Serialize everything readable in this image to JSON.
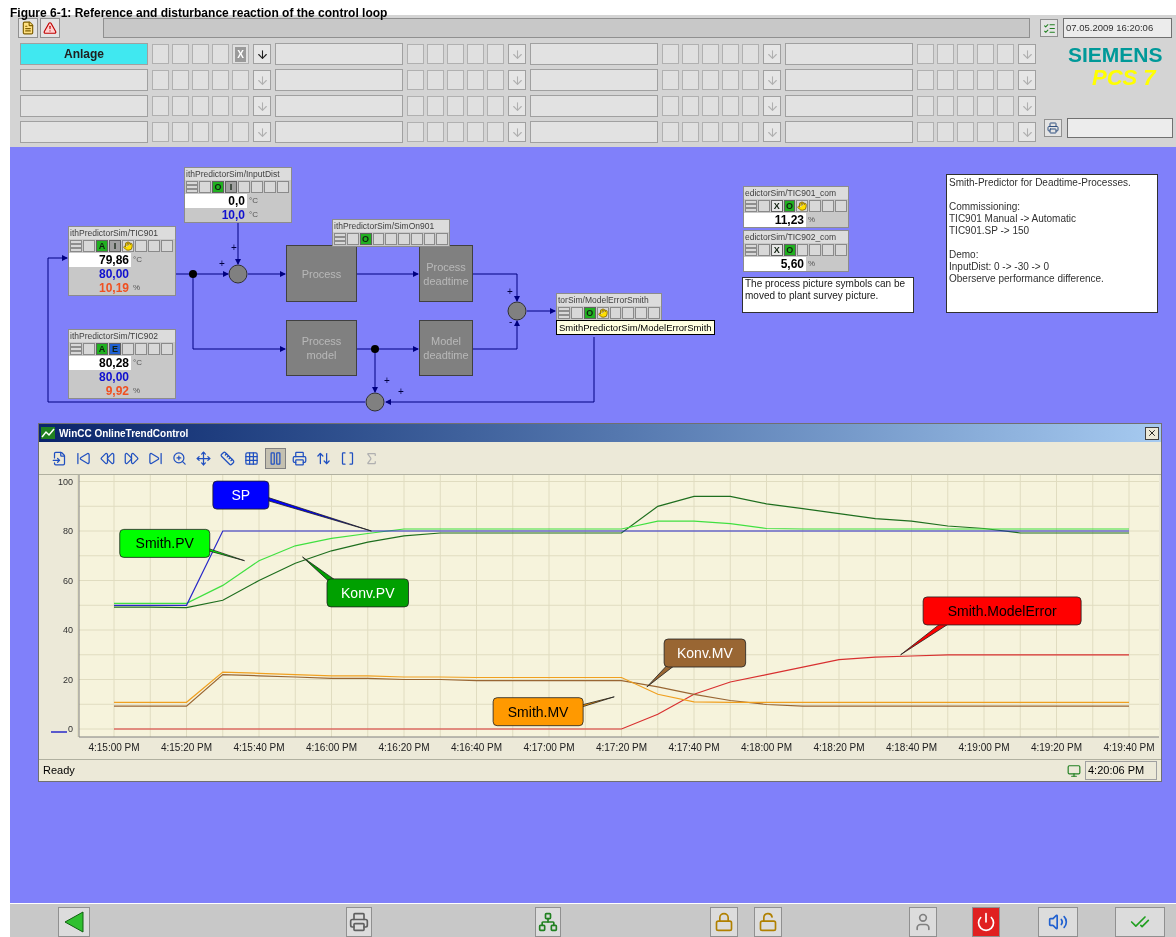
{
  "caption": "Figure 6-1: Reference and disturbance reaction of the control loop",
  "header": {
    "date": "07.05.2009 16:20:06",
    "logo": {
      "brand": "SIEMENS",
      "product": "PCS 7"
    },
    "area_rows": [
      [
        {
          "label": "Anlage",
          "selected": true,
          "marker": "X",
          "arrow_disabled": false
        },
        {
          "selected": false,
          "arrow_disabled": true
        },
        {
          "selected": false,
          "arrow_disabled": true
        },
        {
          "selected": false,
          "arrow_disabled": true
        }
      ],
      [
        {
          "selected": false,
          "arrow_disabled": true
        },
        {
          "selected": false,
          "arrow_disabled": true
        },
        {
          "selected": false,
          "arrow_disabled": true
        },
        {
          "selected": false,
          "arrow_disabled": true
        }
      ],
      [
        {
          "selected": false,
          "arrow_disabled": true
        },
        {
          "selected": false,
          "arrow_disabled": true
        },
        {
          "selected": false,
          "arrow_disabled": true
        },
        {
          "selected": false,
          "arrow_disabled": true
        }
      ],
      [
        {
          "selected": false,
          "arrow_disabled": true
        },
        {
          "selected": false,
          "arrow_disabled": true
        },
        {
          "selected": false,
          "arrow_disabled": true
        },
        {
          "selected": false,
          "arrow_disabled": true
        }
      ]
    ]
  },
  "diagram": {
    "faceplates": [
      {
        "title": "ithPredictorSim/InputDist",
        "buttons": [
          {
            "label": "O",
            "color": "#20b020"
          },
          {
            "label": "I",
            "color": "#a0a0a0"
          }
        ],
        "hand": false,
        "values": [
          {
            "value": "0,0",
            "unit": "°C",
            "kind": "pv"
          },
          {
            "value": "10,0",
            "unit": "°C",
            "kind": "sp"
          }
        ]
      },
      {
        "title": "ithPredictorSim/TIC901",
        "buttons": [
          {
            "label": "A",
            "color": "#20b020"
          },
          {
            "label": "I",
            "color": "#a0a0a0"
          }
        ],
        "hand": true,
        "values": [
          {
            "value": "79,86",
            "unit": "°C",
            "kind": "pv"
          },
          {
            "value": "80,00",
            "kind": "sp"
          },
          {
            "value": "10,19",
            "unit": "%",
            "kind": "mv"
          }
        ]
      },
      {
        "title": "ithPredictorSim/TIC902",
        "buttons": [
          {
            "label": "A",
            "color": "#20b020"
          },
          {
            "label": "E",
            "color": "#2060d0"
          }
        ],
        "hand": false,
        "values": [
          {
            "value": "80,28",
            "unit": "°C",
            "kind": "pv"
          },
          {
            "value": "80,00",
            "kind": "sp"
          },
          {
            "value": "9,92",
            "unit": "%",
            "kind": "mv"
          }
        ]
      },
      {
        "title": "ithPredictorSim/SimOn901",
        "buttons": [
          {
            "label": "O",
            "color": "#20b020"
          }
        ],
        "hand": false
      },
      {
        "title": "torSim/ModelErrorSmith",
        "buttons": [
          {
            "label": "O",
            "color": "#20b020"
          }
        ],
        "hand": true
      },
      {
        "title": "edictorSim/TIC901_com",
        "buttons": [
          {
            "label": "X",
            "color": "#e8e8e8"
          },
          {
            "label": "O",
            "color": "#20b020"
          }
        ],
        "hand": true,
        "values": [
          {
            "value": "11,23",
            "unit": "%",
            "kind": "pv"
          }
        ]
      },
      {
        "title": "edictorSim/TIC902_com",
        "buttons": [
          {
            "label": "X",
            "color": "#e8e8e8"
          },
          {
            "label": "O",
            "color": "#20b020"
          }
        ],
        "hand": false,
        "values": [
          {
            "value": "5,60",
            "unit": "%",
            "kind": "pv"
          }
        ]
      }
    ],
    "tooltip": "SmithPredictorSim/ModelErrorSmith",
    "blocks": [
      {
        "label": "Process"
      },
      {
        "label": "Process deadtime"
      },
      {
        "label": "Process model"
      },
      {
        "label": "Model deadtime"
      }
    ],
    "signs": [
      "+",
      "+",
      "+",
      "-",
      "+",
      "+"
    ],
    "note": "The process picture symbols can be moved to plant survey picture.",
    "info": [
      [
        "Smith-Predictor for Deadtime-Processes."
      ],
      [
        "Commissioning:",
        "TIC901 Manual -> Automatic",
        "TIC901.SP -> 150"
      ],
      [
        "Demo:",
        "InputDist: 0 -> -30 -> 0",
        "Oberserve performance difference."
      ]
    ]
  },
  "trend": {
    "title": "WinCC OnlineTrendControl",
    "status": "Ready",
    "time": "4:20:06 PM",
    "callouts": [
      {
        "color": "#0000ff",
        "dark_text": false
      },
      {
        "color": "#00ff00",
        "dark_text": true
      },
      {
        "color": "#00a000",
        "dark_text": false
      },
      {
        "color": "#ff9900",
        "dark_text": true
      },
      {
        "color": "#996633",
        "dark_text": false
      },
      {
        "color": "#ff0000",
        "dark_text": true
      }
    ],
    "chart_data": {
      "type": "line",
      "categories": [
        "4:15:00 PM",
        null,
        "4:15:20 PM",
        null,
        "4:15:40 PM",
        null,
        "4:16:00 PM",
        null,
        "4:16:20 PM",
        null,
        "4:16:40 PM",
        null,
        "4:17:00 PM",
        null,
        "4:17:20 PM",
        null,
        "4:17:40 PM",
        null,
        "4:18:00 PM",
        null,
        "4:18:20 PM",
        null,
        "4:18:40 PM",
        null,
        "4:19:00 PM",
        null,
        "4:19:20 PM",
        null,
        "4:19:40 PM"
      ],
      "ylim": [
        0,
        100
      ],
      "grid": true,
      "yticks": [
        0,
        20,
        40,
        60,
        80,
        100
      ],
      "series": [
        {
          "name": "SP",
          "color": "#2828c8",
          "values": [
            50,
            50,
            50,
            80,
            80,
            80,
            80,
            80,
            80,
            80,
            80,
            80,
            80,
            80,
            80,
            80,
            80,
            80,
            80,
            80,
            80,
            80,
            80,
            80,
            80,
            80,
            80,
            80,
            80
          ]
        },
        {
          "name": "Smith.PV",
          "color": "#40e040",
          "values": [
            50.8,
            50.8,
            50.8,
            58,
            68,
            74,
            77,
            79,
            80.8,
            80.8,
            80.8,
            80.8,
            80.8,
            80.8,
            80.8,
            84,
            84,
            83,
            81,
            80.8,
            80.8,
            80.8,
            80.8,
            80.8,
            80.8,
            80.8,
            80.8,
            80.8,
            80.8
          ]
        },
        {
          "name": "Konv.PV",
          "color": "#1e6e1e",
          "values": [
            49.2,
            49.2,
            49,
            52,
            60,
            67,
            72,
            75.5,
            78,
            79.2,
            79.2,
            79.2,
            79.2,
            79.2,
            79.2,
            90,
            94,
            94,
            91,
            89,
            87,
            85,
            84,
            82,
            81,
            79.2,
            79.2,
            79.2,
            79.2
          ]
        },
        {
          "name": "Smith.MV",
          "color": "#f0a020",
          "values": [
            10.8,
            10.8,
            10.8,
            23,
            22.5,
            22,
            21.5,
            21.5,
            21,
            21,
            20.8,
            20.8,
            20.8,
            20.8,
            20.8,
            14,
            11,
            10.8,
            10.8,
            10.8,
            10.8,
            10.8,
            10.8,
            10.8,
            10.8,
            10.8,
            10.8,
            10.8,
            10.8
          ]
        },
        {
          "name": "Konv.MV",
          "color": "#996633",
          "values": [
            9.2,
            9.2,
            9.2,
            22,
            21.5,
            21,
            20.5,
            20.5,
            20,
            20,
            19.5,
            19.5,
            19.5,
            19.5,
            19.5,
            17,
            14,
            11.5,
            9.9,
            9.2,
            9.2,
            9.2,
            9.2,
            9.2,
            9.2,
            9.2,
            9.2,
            9.2,
            9.2
          ]
        },
        {
          "name": "Smith.ModelError",
          "color": "#d83030",
          "values": [
            0,
            0,
            0,
            0,
            0,
            0,
            0,
            0,
            0,
            0,
            0,
            0,
            0,
            0,
            0,
            6,
            14,
            19,
            22,
            25,
            28,
            29,
            29.5,
            30,
            30,
            30,
            30,
            30,
            30
          ]
        }
      ]
    }
  }
}
